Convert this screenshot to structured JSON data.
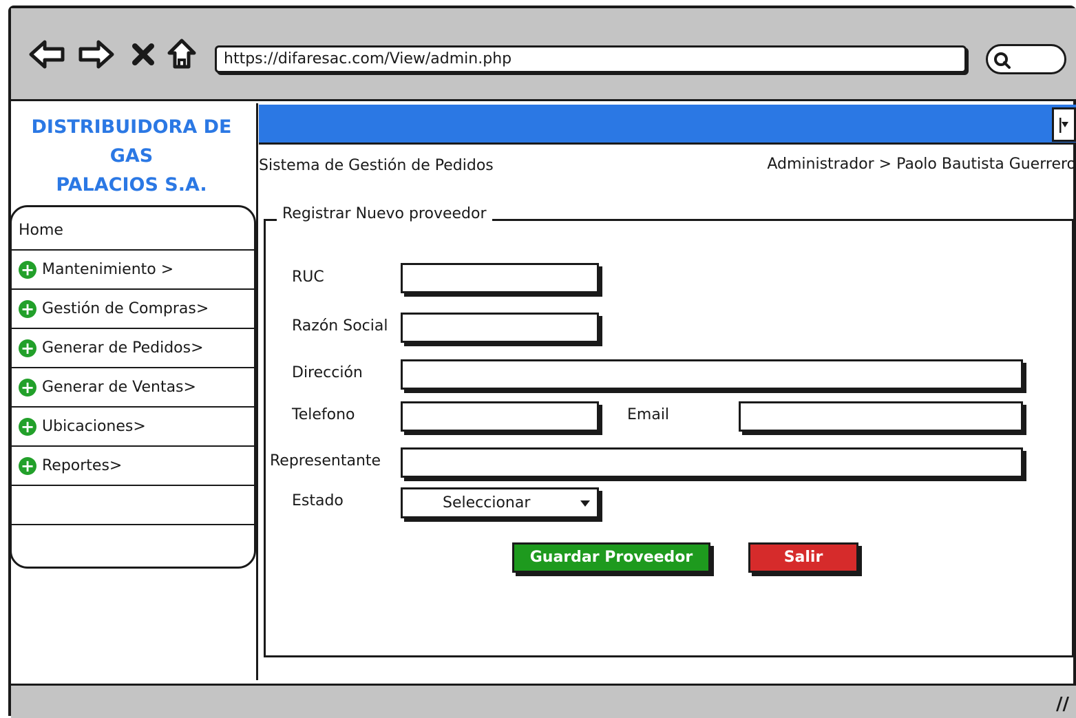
{
  "browser": {
    "url": "https://difaresac.com/View/admin.php",
    "nav_icons": [
      "back-arrow-icon",
      "forward-arrow-icon",
      "close-x-icon",
      "home-icon"
    ],
    "search_icon": "search-icon"
  },
  "brand": {
    "line1": "DISTRIBUIDORA DE GAS",
    "line2": "PALACIOS S.A.",
    "color": "#2b78e4"
  },
  "sidebar": {
    "items": [
      {
        "label": "Home",
        "icon": null
      },
      {
        "label": "Mantenimiento >",
        "icon": "plus-circle-icon"
      },
      {
        "label": "Gestión de Compras>",
        "icon": "plus-circle-icon"
      },
      {
        "label": "Generar de Pedidos>",
        "icon": "plus-circle-icon"
      },
      {
        "label": "Generar de Ventas>",
        "icon": "plus-circle-icon"
      },
      {
        "label": "Ubicaciones>",
        "icon": "plus-circle-icon"
      },
      {
        "label": "Reportes>",
        "icon": "plus-circle-icon"
      },
      {
        "label": "",
        "icon": null
      }
    ],
    "icon_color": "#22a02a"
  },
  "header": {
    "bar_color": "#2b78e4",
    "system_title": "Sistema de Gestión de Pedidos",
    "user_path": "Administrador > Paolo Bautista Guerrero"
  },
  "form": {
    "legend": "Registrar Nuevo proveedor",
    "labels": {
      "ruc": "RUC",
      "razon_social": "Razón Social",
      "direccion": "Dirección",
      "telefono": "Telefono",
      "email": "Email",
      "representante": "Representante",
      "estado": "Estado"
    },
    "values": {
      "ruc": "",
      "razon_social": "",
      "direccion": "",
      "telefono": "",
      "email": "",
      "representante": ""
    },
    "estado_selected": "Seleccionar",
    "save_label": "Guardar Proveedor",
    "save_color": "#1e9a1e",
    "exit_label": "Salir",
    "exit_color": "#d62b2b"
  }
}
